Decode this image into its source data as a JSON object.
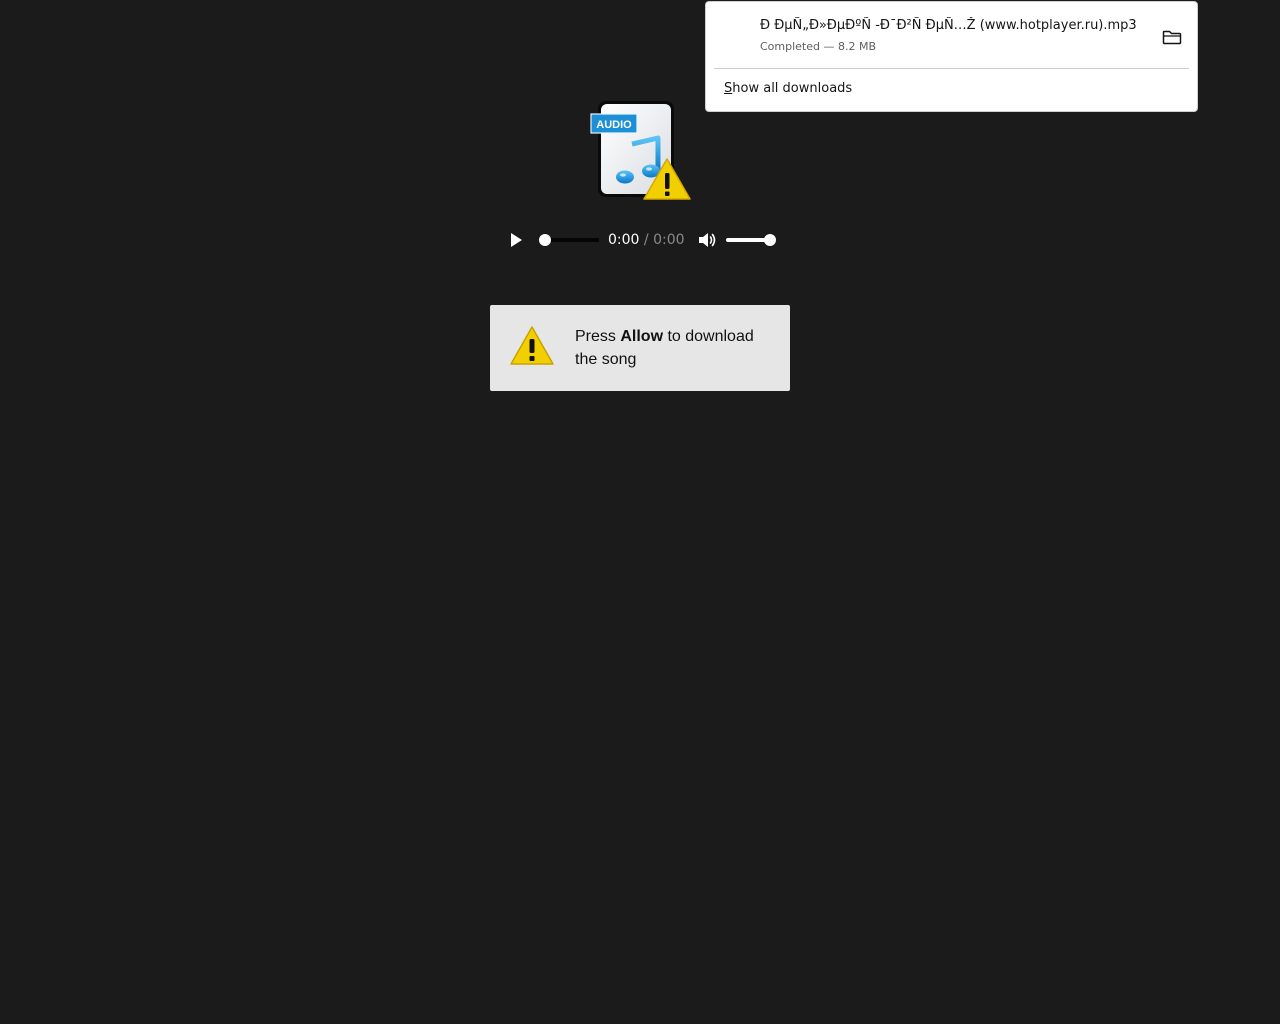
{
  "file_icon": {
    "badge_text": "AUDIO",
    "icon": "audio-file-warning-icon"
  },
  "player": {
    "current_time": "0:00",
    "separator": "/",
    "duration": "0:00",
    "play_icon": "play-icon",
    "volume_icon": "speaker-icon",
    "progress": 0,
    "volume": 1
  },
  "notice": {
    "prefix": "Press ",
    "emphasis": "Allow",
    "suffix": " to download the song",
    "icon": "warning-icon"
  },
  "downloads": {
    "filename": "Ð ÐµÑ„Ð»ÐµÐºÑ -Ð¯Ð²Ñ ÐµÑ…Ž (www.hotplayer.ru).mp3",
    "status": "Completed — 8.2 MB",
    "folder_icon": "folder-icon",
    "show_all_accesskey": "S",
    "show_all_rest": "how all downloads"
  },
  "colors": {
    "page_background": "#1b1b1b",
    "notice_background": "#e6e6e6",
    "warning_yellow": "#f2cf00",
    "audio_badge_blue": "#1d8fd6"
  }
}
